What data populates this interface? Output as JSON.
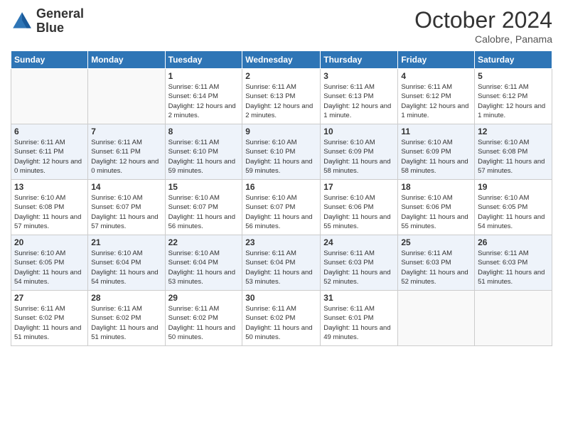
{
  "logo": {
    "line1": "General",
    "line2": "Blue"
  },
  "title": "October 2024",
  "subtitle": "Calobre, Panama",
  "days_of_week": [
    "Sunday",
    "Monday",
    "Tuesday",
    "Wednesday",
    "Thursday",
    "Friday",
    "Saturday"
  ],
  "weeks": [
    [
      {
        "day": "",
        "info": ""
      },
      {
        "day": "",
        "info": ""
      },
      {
        "day": "1",
        "info": "Sunrise: 6:11 AM\nSunset: 6:14 PM\nDaylight: 12 hours and 2 minutes."
      },
      {
        "day": "2",
        "info": "Sunrise: 6:11 AM\nSunset: 6:13 PM\nDaylight: 12 hours and 2 minutes."
      },
      {
        "day": "3",
        "info": "Sunrise: 6:11 AM\nSunset: 6:13 PM\nDaylight: 12 hours and 1 minute."
      },
      {
        "day": "4",
        "info": "Sunrise: 6:11 AM\nSunset: 6:12 PM\nDaylight: 12 hours and 1 minute."
      },
      {
        "day": "5",
        "info": "Sunrise: 6:11 AM\nSunset: 6:12 PM\nDaylight: 12 hours and 1 minute."
      }
    ],
    [
      {
        "day": "6",
        "info": "Sunrise: 6:11 AM\nSunset: 6:11 PM\nDaylight: 12 hours and 0 minutes."
      },
      {
        "day": "7",
        "info": "Sunrise: 6:11 AM\nSunset: 6:11 PM\nDaylight: 12 hours and 0 minutes."
      },
      {
        "day": "8",
        "info": "Sunrise: 6:11 AM\nSunset: 6:10 PM\nDaylight: 11 hours and 59 minutes."
      },
      {
        "day": "9",
        "info": "Sunrise: 6:10 AM\nSunset: 6:10 PM\nDaylight: 11 hours and 59 minutes."
      },
      {
        "day": "10",
        "info": "Sunrise: 6:10 AM\nSunset: 6:09 PM\nDaylight: 11 hours and 58 minutes."
      },
      {
        "day": "11",
        "info": "Sunrise: 6:10 AM\nSunset: 6:09 PM\nDaylight: 11 hours and 58 minutes."
      },
      {
        "day": "12",
        "info": "Sunrise: 6:10 AM\nSunset: 6:08 PM\nDaylight: 11 hours and 57 minutes."
      }
    ],
    [
      {
        "day": "13",
        "info": "Sunrise: 6:10 AM\nSunset: 6:08 PM\nDaylight: 11 hours and 57 minutes."
      },
      {
        "day": "14",
        "info": "Sunrise: 6:10 AM\nSunset: 6:07 PM\nDaylight: 11 hours and 57 minutes."
      },
      {
        "day": "15",
        "info": "Sunrise: 6:10 AM\nSunset: 6:07 PM\nDaylight: 11 hours and 56 minutes."
      },
      {
        "day": "16",
        "info": "Sunrise: 6:10 AM\nSunset: 6:07 PM\nDaylight: 11 hours and 56 minutes."
      },
      {
        "day": "17",
        "info": "Sunrise: 6:10 AM\nSunset: 6:06 PM\nDaylight: 11 hours and 55 minutes."
      },
      {
        "day": "18",
        "info": "Sunrise: 6:10 AM\nSunset: 6:06 PM\nDaylight: 11 hours and 55 minutes."
      },
      {
        "day": "19",
        "info": "Sunrise: 6:10 AM\nSunset: 6:05 PM\nDaylight: 11 hours and 54 minutes."
      }
    ],
    [
      {
        "day": "20",
        "info": "Sunrise: 6:10 AM\nSunset: 6:05 PM\nDaylight: 11 hours and 54 minutes."
      },
      {
        "day": "21",
        "info": "Sunrise: 6:10 AM\nSunset: 6:04 PM\nDaylight: 11 hours and 54 minutes."
      },
      {
        "day": "22",
        "info": "Sunrise: 6:10 AM\nSunset: 6:04 PM\nDaylight: 11 hours and 53 minutes."
      },
      {
        "day": "23",
        "info": "Sunrise: 6:11 AM\nSunset: 6:04 PM\nDaylight: 11 hours and 53 minutes."
      },
      {
        "day": "24",
        "info": "Sunrise: 6:11 AM\nSunset: 6:03 PM\nDaylight: 11 hours and 52 minutes."
      },
      {
        "day": "25",
        "info": "Sunrise: 6:11 AM\nSunset: 6:03 PM\nDaylight: 11 hours and 52 minutes."
      },
      {
        "day": "26",
        "info": "Sunrise: 6:11 AM\nSunset: 6:03 PM\nDaylight: 11 hours and 51 minutes."
      }
    ],
    [
      {
        "day": "27",
        "info": "Sunrise: 6:11 AM\nSunset: 6:02 PM\nDaylight: 11 hours and 51 minutes."
      },
      {
        "day": "28",
        "info": "Sunrise: 6:11 AM\nSunset: 6:02 PM\nDaylight: 11 hours and 51 minutes."
      },
      {
        "day": "29",
        "info": "Sunrise: 6:11 AM\nSunset: 6:02 PM\nDaylight: 11 hours and 50 minutes."
      },
      {
        "day": "30",
        "info": "Sunrise: 6:11 AM\nSunset: 6:02 PM\nDaylight: 11 hours and 50 minutes."
      },
      {
        "day": "31",
        "info": "Sunrise: 6:11 AM\nSunset: 6:01 PM\nDaylight: 11 hours and 49 minutes."
      },
      {
        "day": "",
        "info": ""
      },
      {
        "day": "",
        "info": ""
      }
    ]
  ]
}
